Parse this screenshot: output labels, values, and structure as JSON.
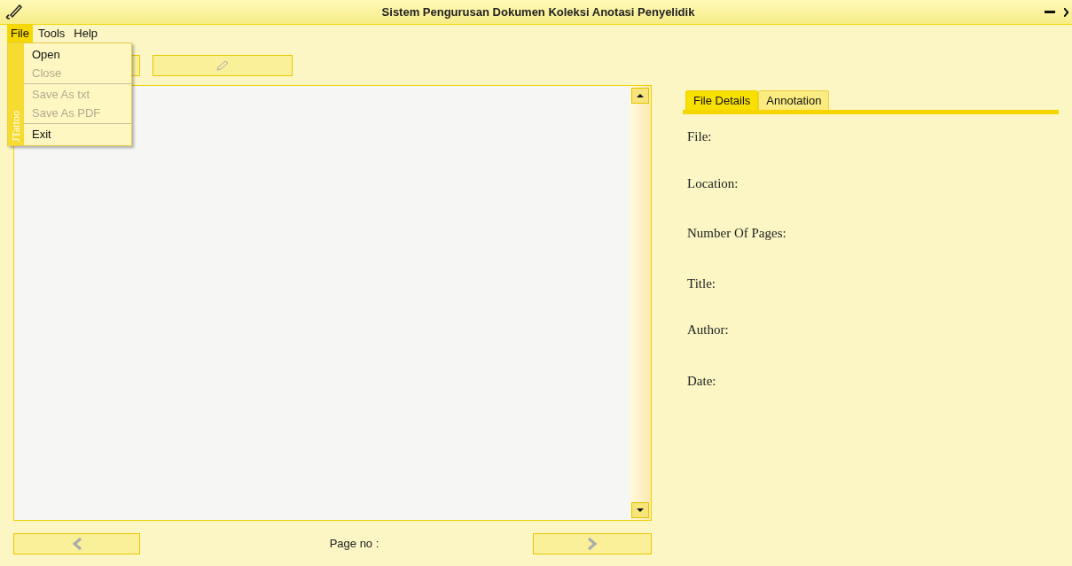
{
  "window": {
    "title": "Sistem Pengurusan Dokumen Koleksi Anotasi Penyelidik"
  },
  "menu_bar": [
    {
      "label": "File",
      "selected": true
    },
    {
      "label": "Tools",
      "selected": false
    },
    {
      "label": "Help",
      "selected": false
    }
  ],
  "file_menu": {
    "side_label": "JTattoo",
    "items": [
      {
        "label": "Open",
        "disabled": false,
        "separator_after": false
      },
      {
        "label": "Close",
        "disabled": true,
        "separator_after": true
      },
      {
        "label": "Save As txt",
        "disabled": true,
        "separator_after": false
      },
      {
        "label": "Save As PDF",
        "disabled": true,
        "separator_after": true
      },
      {
        "label": "Exit",
        "disabled": false,
        "separator_after": false
      }
    ]
  },
  "tabs": [
    {
      "label": "File Details",
      "selected": true
    },
    {
      "label": "Annotation",
      "selected": false
    }
  ],
  "details": [
    "File:",
    "Location:",
    "Number Of Pages:",
    "Title:",
    "Author:",
    "Date:"
  ],
  "pager": {
    "label": "Page no :"
  }
}
